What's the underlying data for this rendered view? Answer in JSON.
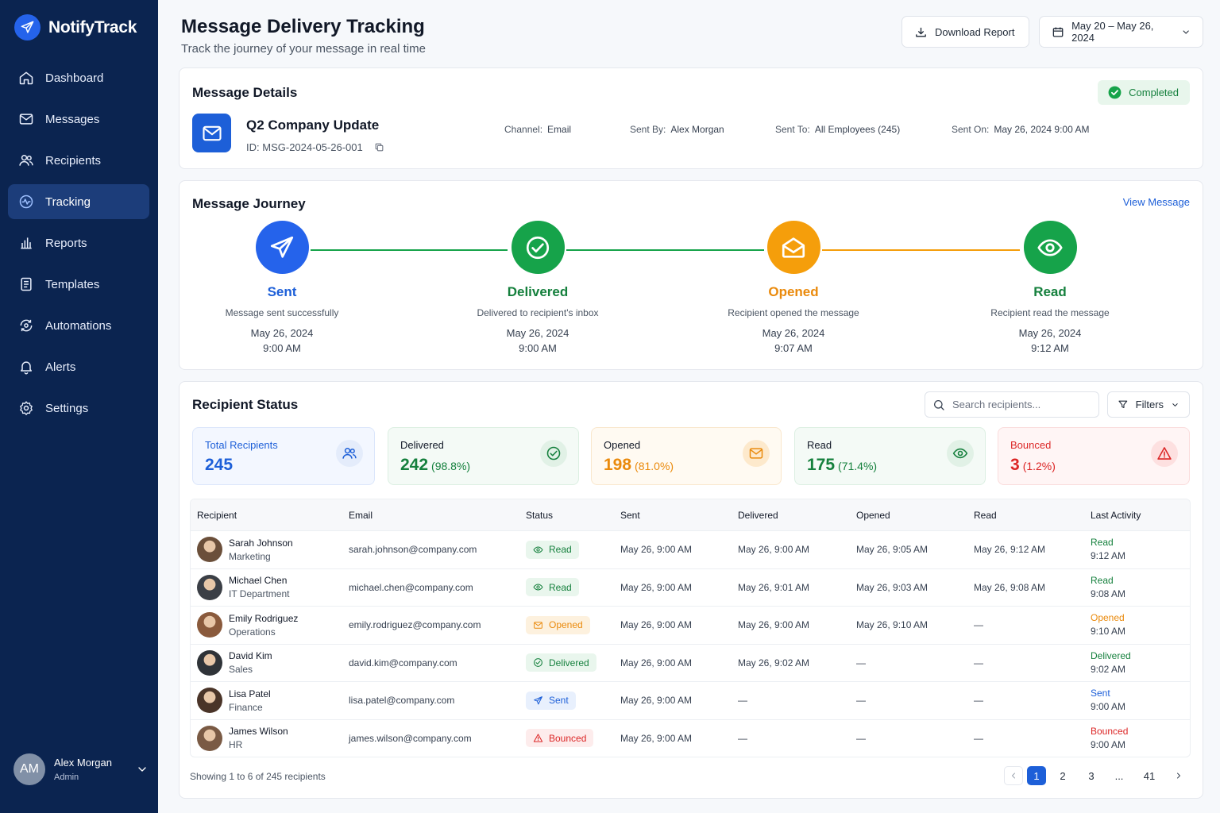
{
  "app": {
    "name": "NotifyTrack"
  },
  "nav": [
    {
      "label": "Dashboard",
      "icon": "home-icon"
    },
    {
      "label": "Messages",
      "icon": "mail-icon"
    },
    {
      "label": "Recipients",
      "icon": "users-icon"
    },
    {
      "label": "Tracking",
      "icon": "activity-icon",
      "active": true
    },
    {
      "label": "Reports",
      "icon": "bar-chart-icon"
    },
    {
      "label": "Templates",
      "icon": "document-icon"
    },
    {
      "label": "Automations",
      "icon": "automation-icon"
    },
    {
      "label": "Alerts",
      "icon": "bell-icon"
    },
    {
      "label": "Settings",
      "icon": "gear-icon"
    }
  ],
  "user": {
    "initials": "AM",
    "name": "Alex Morgan",
    "role": "Admin"
  },
  "header": {
    "title": "Message Delivery Tracking",
    "subtitle": "Track the journey of your message in real time",
    "download_label": "Download Report",
    "date_range": "May 20 – May 26, 2024"
  },
  "details": {
    "title": "Message Details",
    "status": "Completed",
    "message_name": "Q2 Company Update",
    "id_label": "ID:",
    "id_value": "MSG-2024-05-26-001",
    "channel_label": "Channel:",
    "channel": "Email",
    "sent_by_label": "Sent By:",
    "sent_by": "Alex Morgan",
    "sent_to_label": "Sent To:",
    "sent_to": "All Employees (245)",
    "sent_on_label": "Sent On:",
    "sent_on": "May 26, 2024 9:00 AM"
  },
  "journey": {
    "title": "Message Journey",
    "view_label": "View Message",
    "steps": [
      {
        "name": "Sent",
        "desc": "Message sent successfully",
        "date": "May 26, 2024",
        "time": "9:00 AM",
        "color": "#2563eb",
        "icon": "send-icon"
      },
      {
        "name": "Delivered",
        "desc": "Delivered to recipient's inbox",
        "date": "May 26, 2024",
        "time": "9:00 AM",
        "color": "#16a34a",
        "icon": "check-circle-icon"
      },
      {
        "name": "Opened",
        "desc": "Recipient opened the message",
        "date": "May 26, 2024",
        "time": "9:07 AM",
        "color": "#f59e0b",
        "icon": "open-envelope-icon"
      },
      {
        "name": "Read",
        "desc": "Recipient read the message",
        "date": "May 26, 2024",
        "time": "9:12 AM",
        "color": "#16a34a",
        "icon": "eye-icon"
      }
    ]
  },
  "recipients": {
    "title": "Recipient Status",
    "search_placeholder": "Search recipients...",
    "filters_label": "Filters",
    "stats": [
      {
        "label": "Total Recipients",
        "value": "245",
        "pct": "",
        "color": "#1d5fd8",
        "bg": "#f3f7ff",
        "border": "#dbe6fb",
        "icon": "users-icon"
      },
      {
        "label": "Delivered",
        "value": "242",
        "pct": "(98.8%)",
        "color": "#15803d",
        "bg": "#f4faf6",
        "border": "#dcefe2",
        "icon": "check-circle-icon"
      },
      {
        "label": "Opened",
        "value": "198",
        "pct": "(81.0%)",
        "color": "#ea8a0c",
        "bg": "#fffaf2",
        "border": "#f9e7cc",
        "icon": "mail-icon"
      },
      {
        "label": "Read",
        "value": "175",
        "pct": "(71.4%)",
        "color": "#15803d",
        "bg": "#f4faf6",
        "border": "#dcefe2",
        "icon": "eye-icon"
      },
      {
        "label": "Bounced",
        "value": "3",
        "pct": "(1.2%)",
        "color": "#dc2626",
        "bg": "#fff5f5",
        "border": "#fadcdc",
        "icon": "warning-icon"
      }
    ],
    "columns": [
      "Recipient",
      "Email",
      "Status",
      "Sent",
      "Delivered",
      "Opened",
      "Read",
      "Last Activity"
    ],
    "rows": [
      {
        "name": "Sarah Johnson",
        "dept": "Marketing",
        "email": "sarah.johnson@company.com",
        "status": "Read",
        "sent": "May 26, 9:00 AM",
        "delivered": "May 26, 9:00 AM",
        "opened": "May 26, 9:05 AM",
        "read": "May 26, 9:12 AM",
        "last_status": "Read",
        "last_time": "9:12 AM",
        "avatar": "#6b4f3a"
      },
      {
        "name": "Michael Chen",
        "dept": "IT Department",
        "email": "michael.chen@company.com",
        "status": "Read",
        "sent": "May 26, 9:00 AM",
        "delivered": "May 26, 9:01 AM",
        "opened": "May 26, 9:03 AM",
        "read": "May 26, 9:08 AM",
        "last_status": "Read",
        "last_time": "9:08 AM",
        "avatar": "#3b3f46"
      },
      {
        "name": "Emily Rodriguez",
        "dept": "Operations",
        "email": "emily.rodriguez@company.com",
        "status": "Opened",
        "sent": "May 26, 9:00 AM",
        "delivered": "May 26, 9:00 AM",
        "opened": "May 26, 9:10 AM",
        "read": "—",
        "last_status": "Opened",
        "last_time": "9:10 AM",
        "avatar": "#8a5a3c"
      },
      {
        "name": "David Kim",
        "dept": "Sales",
        "email": "david.kim@company.com",
        "status": "Delivered",
        "sent": "May 26, 9:00 AM",
        "delivered": "May 26, 9:02 AM",
        "opened": "—",
        "read": "—",
        "last_status": "Delivered",
        "last_time": "9:02 AM",
        "avatar": "#2f3338"
      },
      {
        "name": "Lisa Patel",
        "dept": "Finance",
        "email": "lisa.patel@company.com",
        "status": "Sent",
        "sent": "May 26, 9:00 AM",
        "delivered": "—",
        "opened": "—",
        "read": "—",
        "last_status": "Sent",
        "last_time": "9:00 AM",
        "avatar": "#4a3428"
      },
      {
        "name": "James Wilson",
        "dept": "HR",
        "email": "james.wilson@company.com",
        "status": "Bounced",
        "sent": "May 26, 9:00 AM",
        "delivered": "—",
        "opened": "—",
        "read": "—",
        "last_status": "Bounced",
        "last_time": "9:00 AM",
        "avatar": "#7a5a44"
      }
    ],
    "showing": "Showing 1 to 6 of 245 recipients",
    "pages": [
      "1",
      "2",
      "3",
      "...",
      "41"
    ],
    "current_page": "1"
  },
  "status_styles": {
    "Read": {
      "color": "#15803d",
      "bg": "#e9f6ed",
      "icon": "eye-icon"
    },
    "Opened": {
      "color": "#ea8a0c",
      "bg": "#fdf1de",
      "icon": "mail-icon"
    },
    "Delivered": {
      "color": "#15803d",
      "bg": "#e9f6ed",
      "icon": "check-circle-icon"
    },
    "Sent": {
      "color": "#1d5fd8",
      "bg": "#e8f0fd",
      "icon": "send-icon"
    },
    "Bounced": {
      "color": "#dc2626",
      "bg": "#fdecec",
      "icon": "warning-icon"
    }
  }
}
